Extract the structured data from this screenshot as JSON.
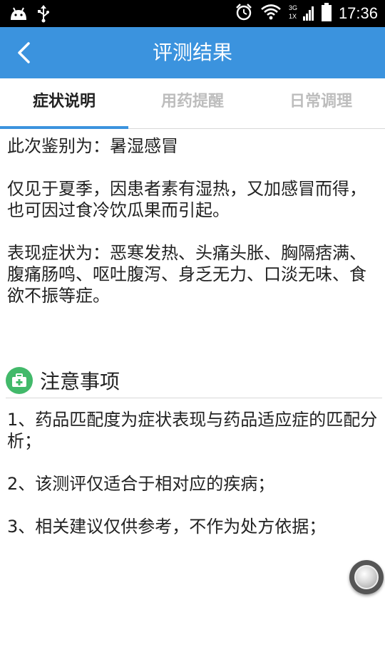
{
  "status_bar": {
    "time": "17:36",
    "network_label": "3G",
    "network_label_2": "1X"
  },
  "header": {
    "title": "评测结果",
    "back_icon": "chevron-left-icon",
    "background_color": "#3b93de"
  },
  "tabs": [
    {
      "label": "症状说明",
      "active": true
    },
    {
      "label": "用药提醒",
      "active": false
    },
    {
      "label": "日常调理",
      "active": false
    }
  ],
  "content": {
    "diagnosis": "此次鉴别为：暑湿感冒",
    "description": "仅见于夏季，因患者素有湿热，又加感冒而得，也可因过食冷饮瓜果而引起。",
    "symptoms": "表现症状为：恶寒发热、头痛头胀、胸隔痞满、腹痛肠鸣、呕吐腹泻、身乏无力、口淡无味、食欲不振等症。"
  },
  "notice": {
    "title": "注意事项",
    "icon": "medical-kit-icon",
    "items": [
      "1、药品匹配度为症状表现与药品适应症的匹配分析；",
      "2、该测评仅适合于相对应的疾病；",
      "3、相关建议仅供参考，不作为处方依据；"
    ]
  },
  "colors": {
    "accent": "#3b93de",
    "notice_icon": "#42b96a"
  }
}
